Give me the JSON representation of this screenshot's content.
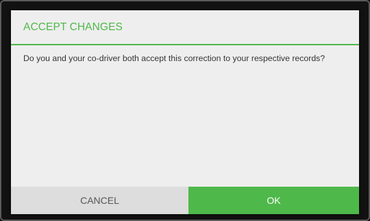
{
  "dialog": {
    "title": "ACCEPT CHANGES",
    "message": "Do you and your co-driver both accept this correction to your respective records?",
    "cancel_label": "CANCEL",
    "ok_label": "OK"
  },
  "colors": {
    "accent": "#4fb84a",
    "dialog_background": "#eeeeee",
    "cancel_background": "#dddddd",
    "backdrop": "#121212"
  }
}
